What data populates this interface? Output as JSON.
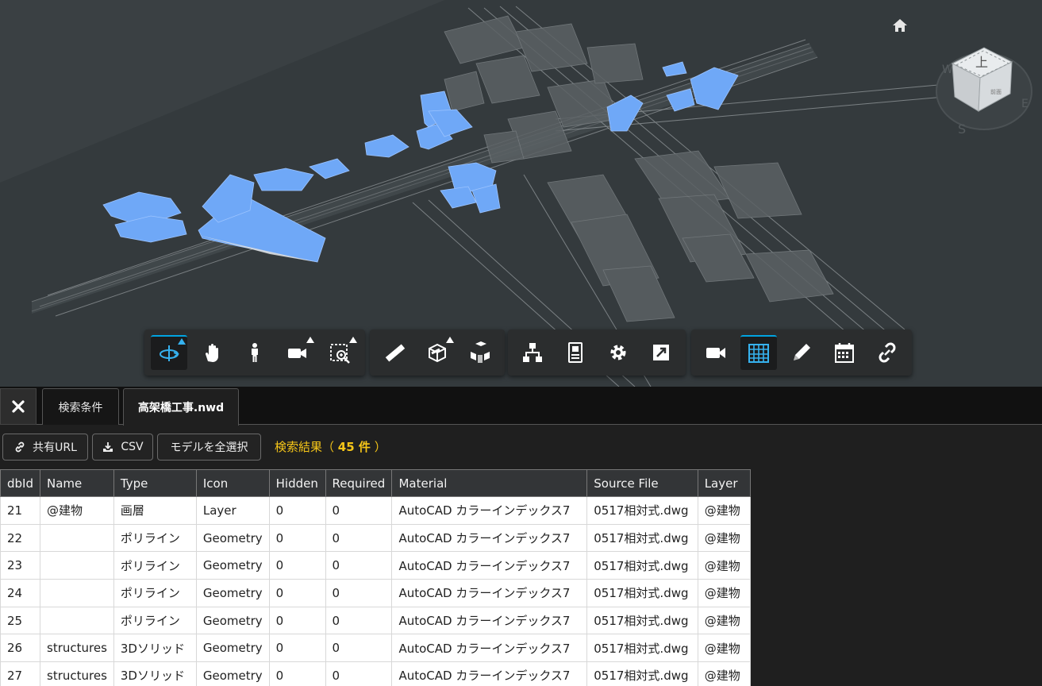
{
  "toolbar": {
    "groups": [
      [
        {
          "name": "orbit",
          "icon": "orbit-icon",
          "active": true,
          "flyout": true
        },
        {
          "name": "pan",
          "icon": "hand-icon",
          "active": false,
          "flyout": false
        },
        {
          "name": "first-person",
          "icon": "person-icon",
          "active": false,
          "flyout": false
        },
        {
          "name": "camera",
          "icon": "video-camera-icon",
          "active": false,
          "flyout": true
        },
        {
          "name": "zoom-window",
          "icon": "zoom-window-icon",
          "active": false,
          "flyout": true
        }
      ],
      [
        {
          "name": "measure",
          "icon": "ruler-icon",
          "active": false,
          "flyout": false
        },
        {
          "name": "section",
          "icon": "section-box-icon",
          "active": false,
          "flyout": true
        },
        {
          "name": "explode",
          "icon": "explode-cubes-icon",
          "active": false,
          "flyout": false
        }
      ],
      [
        {
          "name": "model-browser",
          "icon": "hierarchy-icon",
          "active": false,
          "flyout": false
        },
        {
          "name": "properties",
          "icon": "properties-icon",
          "active": false,
          "flyout": false
        },
        {
          "name": "settings",
          "icon": "gear-icon",
          "active": false,
          "flyout": false
        },
        {
          "name": "fullscreen",
          "icon": "fullscreen-icon",
          "active": false,
          "flyout": false
        }
      ],
      [
        {
          "name": "record",
          "icon": "video-camera-solid-icon",
          "active": false,
          "flyout": false
        },
        {
          "name": "grid-view",
          "icon": "grid-table-icon",
          "active": true,
          "flyout": false
        },
        {
          "name": "markup",
          "icon": "pencil-icon",
          "active": false,
          "flyout": false
        },
        {
          "name": "schedule",
          "icon": "calendar-icon",
          "active": false,
          "flyout": false
        },
        {
          "name": "link",
          "icon": "link-icon",
          "active": false,
          "flyout": false
        }
      ]
    ]
  },
  "viewcube": {
    "top_label": "上",
    "small_label": "前面",
    "compass": {
      "w": "W",
      "e": "E",
      "s": "S"
    }
  },
  "panel": {
    "tabs": [
      {
        "label": "検索条件",
        "active": false
      },
      {
        "label": "高架橋工事.nwd",
        "active": true
      }
    ],
    "actions": {
      "share_url": "共有URL",
      "csv": "CSV",
      "select_all": "モデルを全選択"
    },
    "result": {
      "prefix": "検索結果（",
      "count": "45 件",
      "suffix": "）"
    }
  },
  "table": {
    "columns": [
      "dbId",
      "Name",
      "Type",
      "Icon",
      "Hidden",
      "Required",
      "Material",
      "Source File",
      "Layer"
    ],
    "rows": [
      [
        "21",
        "@建物",
        "画層",
        "Layer",
        "0",
        "0",
        "AutoCAD カラーインデックス7",
        "0517相対式.dwg",
        "@建物"
      ],
      [
        "22",
        "",
        "ポリライン",
        "Geometry",
        "0",
        "0",
        "AutoCAD カラーインデックス7",
        "0517相対式.dwg",
        "@建物"
      ],
      [
        "23",
        "",
        "ポリライン",
        "Geometry",
        "0",
        "0",
        "AutoCAD カラーインデックス7",
        "0517相対式.dwg",
        "@建物"
      ],
      [
        "24",
        "",
        "ポリライン",
        "Geometry",
        "0",
        "0",
        "AutoCAD カラーインデックス7",
        "0517相対式.dwg",
        "@建物"
      ],
      [
        "25",
        "",
        "ポリライン",
        "Geometry",
        "0",
        "0",
        "AutoCAD カラーインデックス7",
        "0517相対式.dwg",
        "@建物"
      ],
      [
        "26",
        "structures",
        "3Dソリッド",
        "Geometry",
        "0",
        "0",
        "AutoCAD カラーインデックス7",
        "0517相対式.dwg",
        "@建物"
      ],
      [
        "27",
        "structures",
        "3Dソリッド",
        "Geometry",
        "0",
        "0",
        "AutoCAD カラーインデックス7",
        "0517相対式.dwg",
        "@建物"
      ]
    ]
  },
  "colors": {
    "accent": "#00a3e0",
    "highlight": "#6fa8f7",
    "result_text": "#f5c518"
  }
}
